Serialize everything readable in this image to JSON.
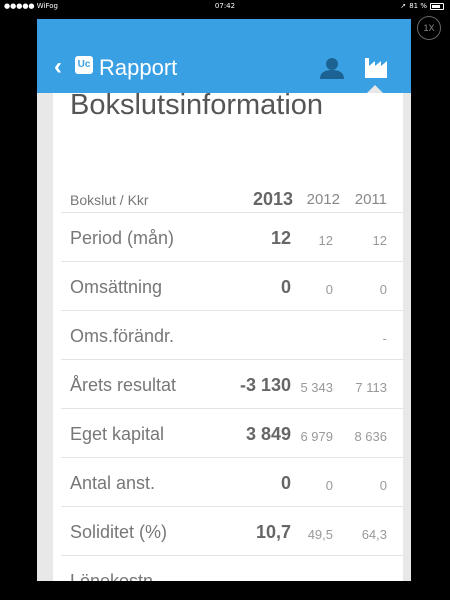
{
  "status_bar": {
    "carrier": "●●●●● WiFog",
    "time": "07:42",
    "battery": "81 %"
  },
  "zoom_badge": "1X",
  "app_bar": {
    "back_icon": "chevron-left",
    "logo_text": "Uc",
    "title": "Rapport",
    "icons": [
      "person-icon",
      "factory-icon"
    ],
    "accent_color": "#3aa0e4"
  },
  "section": {
    "heading": "Bokslutsinformation",
    "table": {
      "header": {
        "label": "Bokslut / Kkr",
        "years": [
          "2013",
          "2012",
          "2011"
        ]
      },
      "rows": [
        {
          "label": "Period (mån)",
          "values": [
            "12",
            "12",
            "12"
          ]
        },
        {
          "label": "Omsättning",
          "values": [
            "0",
            "0",
            "0"
          ]
        },
        {
          "label": "Oms.förändr.",
          "values": [
            "",
            "",
            "-"
          ]
        },
        {
          "label": "Årets resultat",
          "values": [
            "-3 130",
            "5 343",
            "7 113"
          ]
        },
        {
          "label": "Eget kapital",
          "values": [
            "3 849",
            "6 979",
            "8 636"
          ]
        },
        {
          "label": "Antal anst.",
          "values": [
            "0",
            "0",
            "0"
          ]
        },
        {
          "label": "Soliditet (%)",
          "values": [
            "10,7",
            "49,5",
            "64,3"
          ]
        },
        {
          "label": "Lönekostn.",
          "values": [
            "",
            "",
            ""
          ]
        }
      ]
    }
  }
}
